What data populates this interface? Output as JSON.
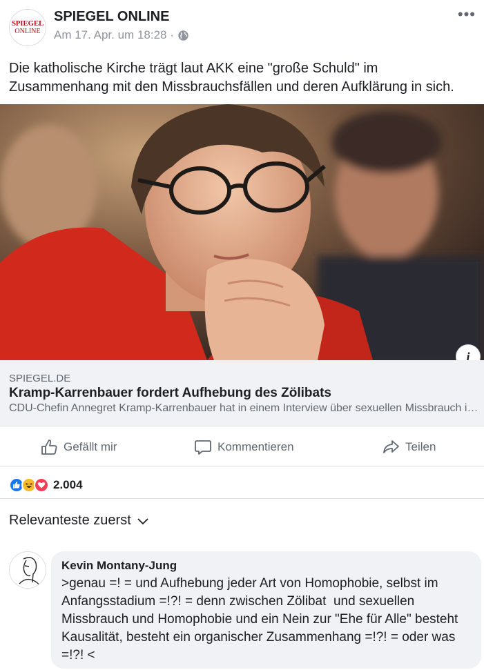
{
  "post": {
    "page_name": "SPIEGEL ONLINE",
    "logo_line1": "SPIEGEL",
    "logo_line2": "ONLINE",
    "timestamp": "Am 17. Apr. um 18:28 ·",
    "privacy_icon": "globe-icon",
    "text": "Die katholische Kirche trägt laut AKK eine \"große Schuld\" im Zusammenhang mit den Missbrauchsfällen und deren Aufklärung in sich."
  },
  "link": {
    "domain": "SPIEGEL.DE",
    "title": "Kramp-Karrenbauer fordert Aufhebung des Zölibats",
    "description": "CDU-Chefin Annegret Kramp-Karrenbauer hat in einem Interview über sexuellen Missbrauch in der katholischen Kirche gesprochen."
  },
  "actions": {
    "like": "Gefällt mir",
    "comment": "Kommentieren",
    "share": "Teilen"
  },
  "reactions": {
    "count": "2.004",
    "types": [
      "like",
      "haha",
      "love"
    ],
    "colors": {
      "like": "#1877f2",
      "haha": "#f7b928",
      "love": "#f33e58"
    }
  },
  "comments": {
    "sort_label": "Relevanteste zuerst",
    "items": [
      {
        "author": "Kevin Montany-Jung",
        "text": ">genau =! = und Aufhebung jeder Art von Homophobie, selbst im Anfangsstadium =!?! = denn zwischen Zölibat  und sexuellen Missbrauch und Homophobie und ein Nein zur \"Ehe für Alle\" besteht  Kausalität, besteht ein organischer Zusammenhang =!?! = oder was =!?! <"
      }
    ]
  }
}
